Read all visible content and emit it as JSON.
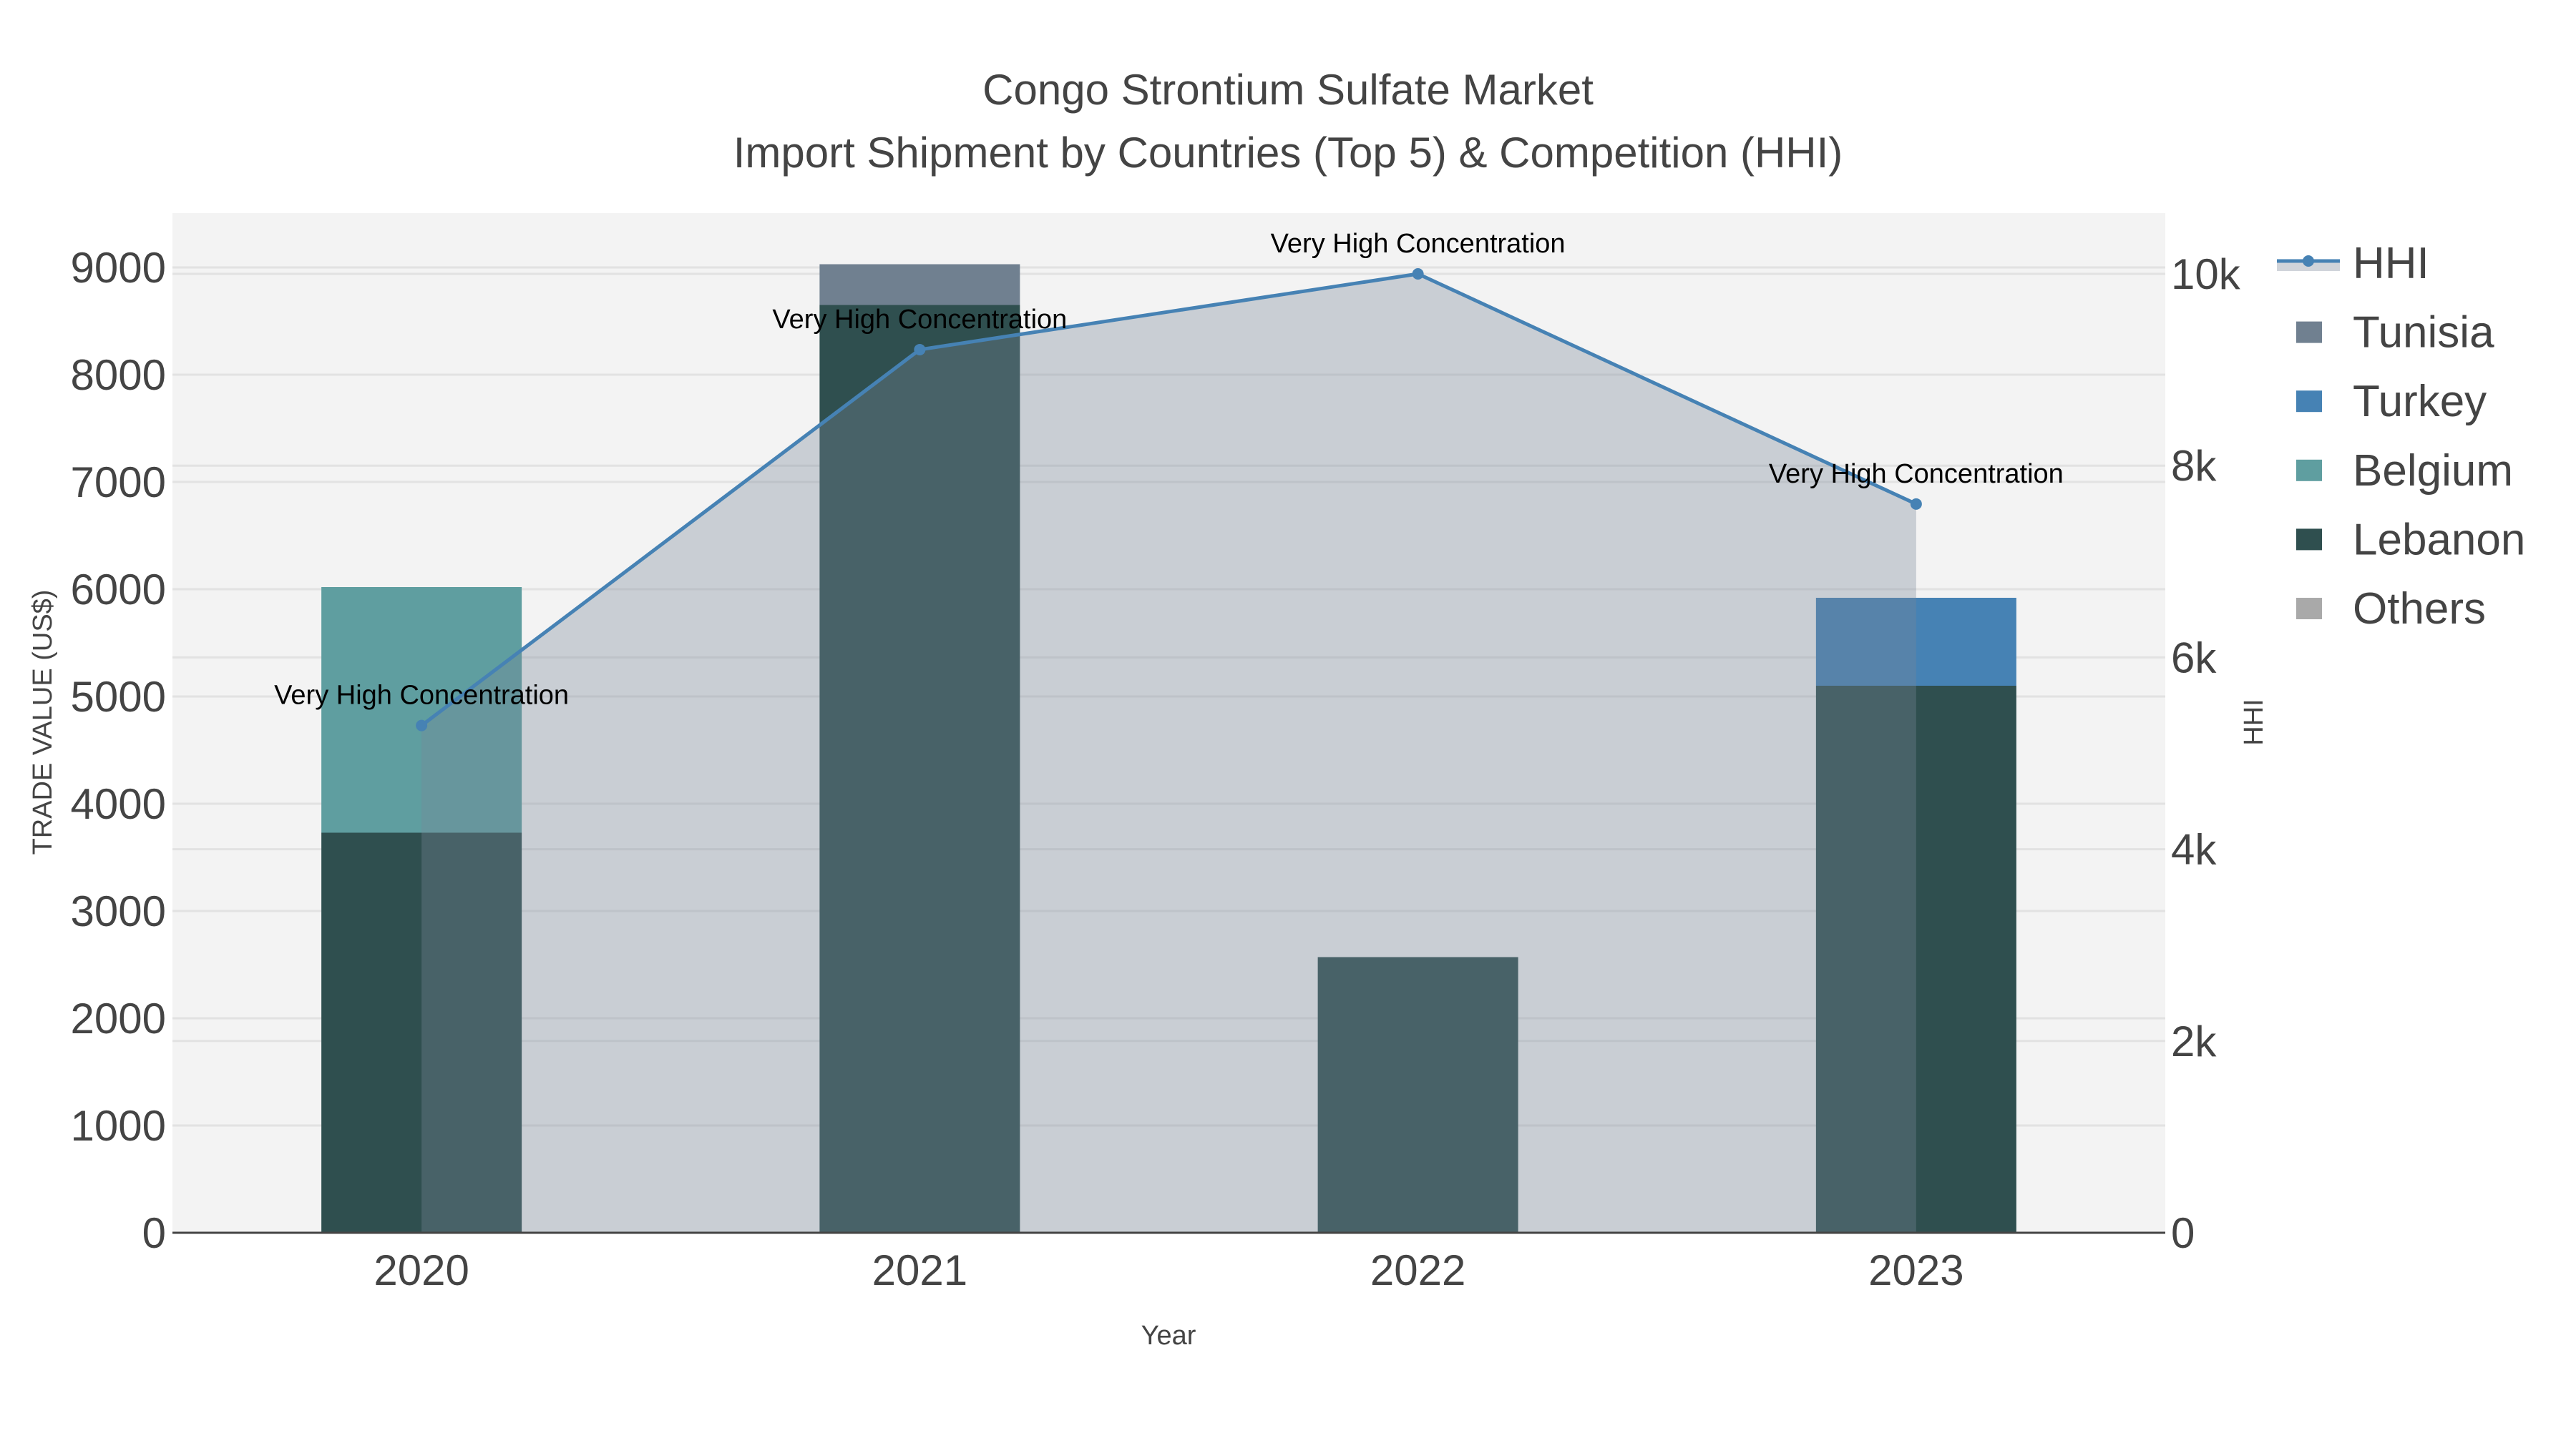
{
  "chart_data": {
    "type": "bar",
    "title": "Congo Strontium Sulfate Market",
    "subtitle": "Import Shipment by Countries (Top 5) & Competition (HHI)",
    "xlabel": "Year",
    "ylabel": "TRADE VALUE (US$)",
    "y2label": "HHI",
    "categories": [
      "2020",
      "2021",
      "2022",
      "2023"
    ],
    "ylim": [
      0,
      9500
    ],
    "y2lim": [
      0,
      10600
    ],
    "yticks": [
      0,
      1000,
      2000,
      3000,
      4000,
      5000,
      6000,
      7000,
      8000,
      9000
    ],
    "y2ticks": [
      0,
      2000,
      4000,
      6000,
      8000,
      10000
    ],
    "y2ticklabels": [
      "0",
      "2k",
      "4k",
      "6k",
      "8k",
      "10k"
    ],
    "barmode": "stack",
    "series": [
      {
        "name": "Lebanon",
        "color": "#2f4f4f",
        "values": [
          3730,
          8650,
          2570,
          5100
        ]
      },
      {
        "name": "Belgium",
        "color": "#5f9ea0",
        "values": [
          2290,
          0,
          0,
          0
        ]
      },
      {
        "name": "Turkey",
        "color": "#4682b4",
        "values": [
          0,
          0,
          0,
          820
        ]
      },
      {
        "name": "Tunisia",
        "color": "#708090",
        "values": [
          0,
          380,
          0,
          0
        ]
      },
      {
        "name": "Others",
        "color": "#a9a9a9",
        "values": [
          0,
          0,
          0,
          0
        ]
      }
    ],
    "hhi": {
      "name": "HHI",
      "type": "line",
      "axis": "right",
      "color": "#4682b4",
      "fill": "rgba(119,136,153,0.34)",
      "values": [
        5290,
        9210,
        10000,
        7600
      ],
      "annotations": [
        "Very High Concentration",
        "Very High Concentration",
        "Very High Concentration",
        "Very High Concentration"
      ]
    },
    "legend_order": [
      "HHI",
      "Tunisia",
      "Turkey",
      "Belgium",
      "Lebanon",
      "Others"
    ],
    "legend_placement": "right",
    "grid": true
  }
}
